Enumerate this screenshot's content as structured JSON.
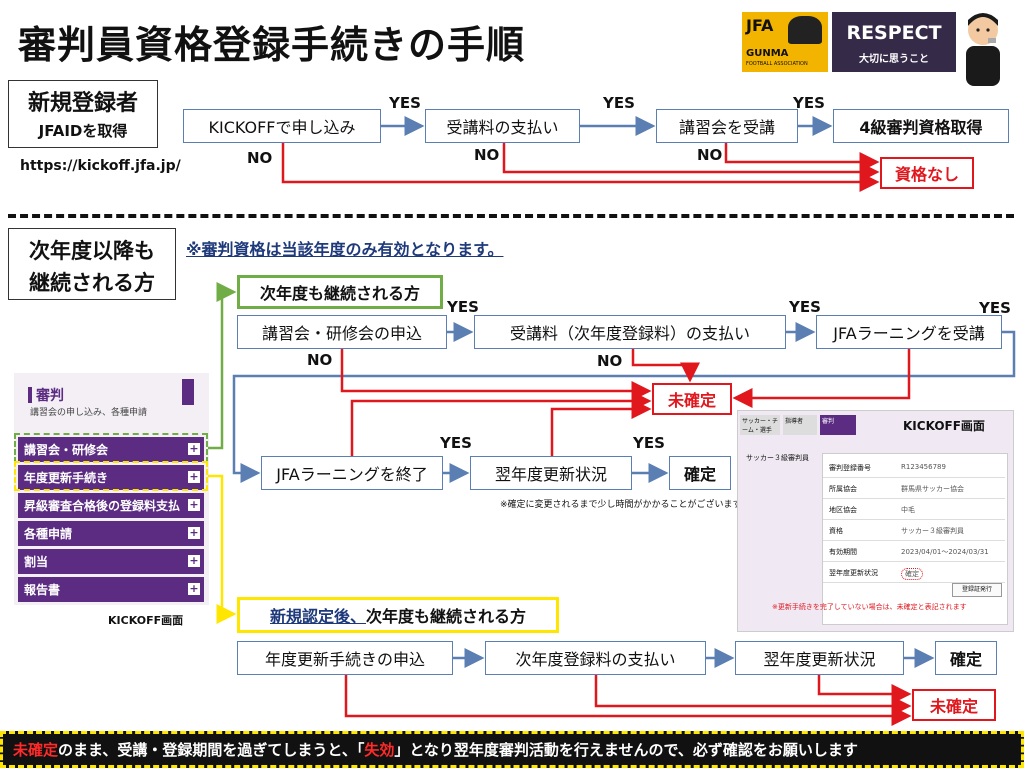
{
  "title": "審判員資格登録手続きの手順",
  "logos": {
    "jfa_top": "JFA",
    "jfa_bottom1": "GUNMA",
    "jfa_bottom2": "FOOTBALL ASSOCIATION",
    "respect_title": "RESPECT",
    "respect_sub": "大切に思うこと"
  },
  "section1": {
    "label_line1": "新規登録者",
    "label_line2": "JFAIDを取得",
    "url": "https://kickoff.jfa.jp/",
    "steps": [
      "KICKOFFで申し込み",
      "受講料の支払い",
      "講習会を受講",
      "4級審判資格取得"
    ],
    "fail": "資格なし",
    "yes": "YES",
    "no": "NO"
  },
  "section2": {
    "label_line1": "次年度以降も",
    "label_line2": "継続される方",
    "note": "※審判資格は当該年度のみ有効となります。",
    "groupA_title": "次年度も継続される方",
    "row1": [
      "講習会・研修会の申込",
      "受講料（次年度登録料）の支払い",
      "JFAラーニングを受講"
    ],
    "row2": [
      "JFAラーニングを終了",
      "翌年度更新状況",
      "確定"
    ],
    "pending": "未確定",
    "caption": "※確定に変更されるまで少し時間がかかることがございます",
    "groupB_title_a": "新規認定後、",
    "groupB_title_b": "次年度も継続される方",
    "row3": [
      "年度更新手続きの申込",
      "次年度登録料の支払い",
      "翌年度更新状況",
      "確定"
    ],
    "pending2": "未確定"
  },
  "kickoff_menu": {
    "header": "審判",
    "sub": "講習会の申し込み、各種申請",
    "items": [
      "講習会・研修会",
      "年度更新手続き",
      "昇級審査合格後の登録料支払",
      "各種申請",
      "割当",
      "報告書"
    ],
    "caption": "KICKOFF画面"
  },
  "kickoff_screen": {
    "caption": "KICKOFF画面",
    "tabs": [
      "サッカー・チーム・選手",
      "指導者",
      "審判"
    ],
    "left_title": "サッカー３級審判員",
    "rows": [
      {
        "k": "審判登録番号",
        "v": "R123456789"
      },
      {
        "k": "所属協会",
        "v": "群馬県サッカー協会"
      },
      {
        "k": "地区協会",
        "v": "中毛"
      },
      {
        "k": "資格",
        "v": "サッカー３級審判員"
      },
      {
        "k": "有効期間",
        "v": "2023/04/01～2024/03/31"
      },
      {
        "k": "翌年度更新状況",
        "v": "確定"
      }
    ],
    "button": "登録証発行",
    "note": "※更新手続きを完了していない場合は、未確定と表記されます"
  },
  "footer": {
    "part1": "未確定",
    "part2": "のまま、受講・登録期間を過ぎてしまうと、「",
    "part3": "失効",
    "part4": "」となり翌年度審判活動を行えませんので、必ず確認をお願いします"
  },
  "colors": {
    "accent": "#5b7fb3",
    "red": "#e0181e",
    "purple": "#5c2c83",
    "green": "#70ad47",
    "yellow": "#ffe600"
  }
}
